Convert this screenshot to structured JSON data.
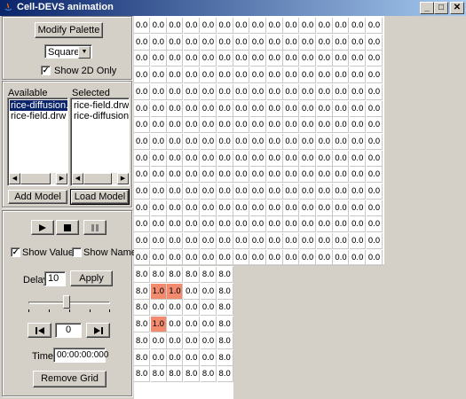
{
  "window": {
    "title": "Cell-DEVS animation"
  },
  "controls": {
    "modify_palette": "Modify Palette",
    "shape_value": "Square",
    "show_2d_only": "Show 2D Only",
    "show_2d_only_checked": true,
    "available_label": "Available",
    "selected_label": "Selected",
    "available_items": [
      "rice-diffusion.drw",
      "rice-field.drw"
    ],
    "available_selected_index": 0,
    "selected_items": [
      "rice-field.drw",
      "rice-diffusion.drw"
    ],
    "add_model": "Add Model",
    "load_model": "Load Model",
    "show_values": "Show Values",
    "show_values_checked": true,
    "show_names": "Show Names",
    "show_names_checked": false,
    "delay_label": "Delay",
    "delay_value": "10",
    "apply": "Apply",
    "delay_slider_fraction": 0.47,
    "frame_value": "0",
    "time_label": "Time",
    "time_value": "00:00:00:000",
    "remove_grid": "Remove Grid"
  },
  "icons": {
    "play": "play-icon",
    "stop": "stop-icon",
    "pause": "pause-icon",
    "step_back": "step-back-icon",
    "step_forward": "step-forward-icon"
  },
  "colors": {
    "highlight_cell": "#f28a6e",
    "selection": "#0a246a"
  },
  "grid1": {
    "rows": [
      [
        "0.0",
        "0.0",
        "0.0",
        "0.0",
        "0.0",
        "0.0",
        "0.0",
        "0.0",
        "0.0",
        "0.0",
        "0.0",
        "0.0",
        "0.0",
        "0.0",
        "0.0"
      ],
      [
        "0.0",
        "0.0",
        "0.0",
        "0.0",
        "0.0",
        "0.0",
        "0.0",
        "0.0",
        "0.0",
        "0.0",
        "0.0",
        "0.0",
        "0.0",
        "0.0",
        "0.0"
      ],
      [
        "0.0",
        "0.0",
        "0.0",
        "0.0",
        "0.0",
        "0.0",
        "0.0",
        "0.0",
        "0.0",
        "0.0",
        "0.0",
        "0.0",
        "0.0",
        "0.0",
        "0.0"
      ],
      [
        "0.0",
        "0.0",
        "0.0",
        "0.0",
        "0.0",
        "0.0",
        "0.0",
        "0.0",
        "0.0",
        "0.0",
        "0.0",
        "0.0",
        "0.0",
        "0.0",
        "0.0"
      ],
      [
        "0.0",
        "0.0",
        "0.0",
        "0.0",
        "0.0",
        "0.0",
        "0.0",
        "0.0",
        "0.0",
        "0.0",
        "0.0",
        "0.0",
        "0.0",
        "0.0",
        "0.0"
      ],
      [
        "0.0",
        "0.0",
        "0.0",
        "0.0",
        "0.0",
        "0.0",
        "0.0",
        "0.0",
        "0.0",
        "0.0",
        "0.0",
        "0.0",
        "0.0",
        "0.0",
        "0.0"
      ],
      [
        "0.0",
        "0.0",
        "0.0",
        "0.0",
        "0.0",
        "0.0",
        "0.0",
        "0.0",
        "0.0",
        "0.0",
        "0.0",
        "0.0",
        "0.0",
        "0.0",
        "0.0"
      ],
      [
        "0.0",
        "0.0",
        "0.0",
        "0.0",
        "0.0",
        "0.0",
        "0.0",
        "0.0",
        "0.0",
        "0.0",
        "0.0",
        "0.0",
        "0.0",
        "0.0",
        "0.0"
      ],
      [
        "0.0",
        "0.0",
        "0.0",
        "0.0",
        "0.0",
        "0.0",
        "0.0",
        "0.0",
        "0.0",
        "0.0",
        "0.0",
        "0.0",
        "0.0",
        "0.0",
        "0.0"
      ],
      [
        "0.0",
        "0.0",
        "0.0",
        "0.0",
        "0.0",
        "0.0",
        "0.0",
        "0.0",
        "0.0",
        "0.0",
        "0.0",
        "0.0",
        "0.0",
        "0.0",
        "0.0"
      ],
      [
        "0.0",
        "0.0",
        "0.0",
        "0.0",
        "0.0",
        "0.0",
        "0.0",
        "0.0",
        "0.0",
        "0.0",
        "0.0",
        "0.0",
        "0.0",
        "0.0",
        "0.0"
      ],
      [
        "0.0",
        "0.0",
        "0.0",
        "0.0",
        "0.0",
        "0.0",
        "0.0",
        "0.0",
        "0.0",
        "0.0",
        "0.0",
        "0.0",
        "0.0",
        "0.0",
        "0.0"
      ],
      [
        "0.0",
        "0.0",
        "0.0",
        "0.0",
        "0.0",
        "0.0",
        "0.0",
        "0.0",
        "0.0",
        "0.0",
        "0.0",
        "0.0",
        "0.0",
        "0.0",
        "0.0"
      ],
      [
        "0.0",
        "0.0",
        "0.0",
        "0.0",
        "0.0",
        "0.0",
        "0.0",
        "0.0",
        "0.0",
        "0.0",
        "0.0",
        "0.0",
        "0.0",
        "0.0",
        "0.0"
      ],
      [
        "0.0",
        "0.0",
        "0.0",
        "0.0",
        "0.0",
        "0.0",
        "0.0",
        "0.0",
        "0.0",
        "0.0",
        "0.0",
        "0.0",
        "0.0",
        "0.0",
        "0.0"
      ]
    ],
    "highlight": []
  },
  "grid2": {
    "rows": [
      [
        "8.0",
        "8.0",
        "8.0",
        "8.0",
        "8.0",
        "8.0"
      ],
      [
        "8.0",
        "1.0",
        "1.0",
        "0.0",
        "0.0",
        "8.0"
      ],
      [
        "8.0",
        "0.0",
        "0.0",
        "0.0",
        "0.0",
        "8.0"
      ],
      [
        "8.0",
        "1.0",
        "0.0",
        "0.0",
        "0.0",
        "8.0"
      ],
      [
        "8.0",
        "0.0",
        "0.0",
        "0.0",
        "0.0",
        "8.0"
      ],
      [
        "8.0",
        "0.0",
        "0.0",
        "0.0",
        "0.0",
        "8.0"
      ],
      [
        "8.0",
        "8.0",
        "8.0",
        "8.0",
        "8.0",
        "8.0"
      ]
    ],
    "highlight": [
      [
        1,
        1
      ],
      [
        1,
        2
      ],
      [
        3,
        1
      ]
    ]
  }
}
